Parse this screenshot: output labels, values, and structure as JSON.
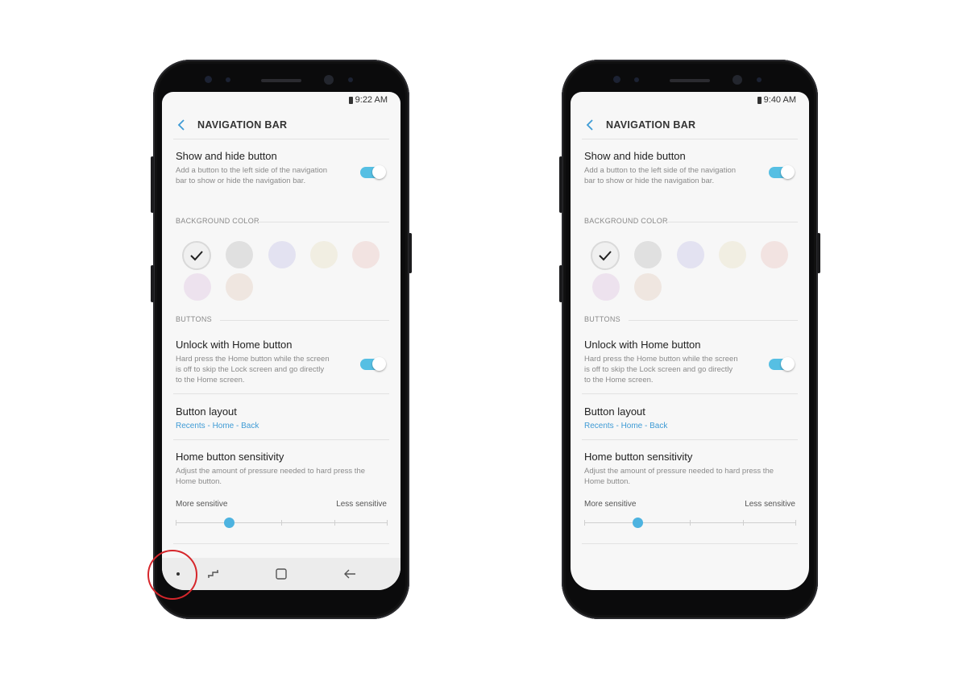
{
  "colors": {
    "accent": "#56bfe3",
    "link": "#3f9bd5",
    "annotation": "#d6262b"
  },
  "icons": {
    "back": "chevron-left-icon",
    "check": "checkmark-icon",
    "nav_dot": "show-hide-dot-icon",
    "nav_recents": "recents-icon",
    "nav_home": "home-icon",
    "nav_back": "back-arrow-icon",
    "battery": "battery-icon"
  },
  "phones": [
    {
      "status_time": "9:22 AM",
      "header_title": "NAVIGATION BAR",
      "show_hide": {
        "title": "Show and hide button",
        "desc": "Add a button to the left side of the navigation bar to show or hide the navigation bar.",
        "enabled": true
      },
      "background_color_label": "BACKGROUND COLOR",
      "swatches": [
        "#f0f0f0",
        "#e0e0e0",
        "#e3e2f1",
        "#f1eee2",
        "#f2e3e1",
        "#ede2ee",
        "#efe6e0"
      ],
      "selected_swatch": 0,
      "buttons_label": "BUTTONS",
      "unlock": {
        "title": "Unlock with Home button",
        "desc": "Hard press the Home button while the screen is off to skip the Lock screen and go directly to the Home screen.",
        "enabled": true
      },
      "layout": {
        "title": "Button layout",
        "value": "Recents - Home - Back"
      },
      "sensitivity": {
        "title": "Home button sensitivity",
        "desc": "Adjust the amount of pressure needed to hard press the Home button.",
        "min_label": "More sensitive",
        "max_label": "Less sensitive",
        "level": 0.25
      },
      "show_navbar": true
    },
    {
      "status_time": "9:40 AM",
      "header_title": "NAVIGATION BAR",
      "show_hide": {
        "title": "Show and hide button",
        "desc": "Add a button to the left side of the navigation bar to show or hide the navigation bar.",
        "enabled": true
      },
      "background_color_label": "BACKGROUND COLOR",
      "swatches": [
        "#f0f0f0",
        "#e0e0e0",
        "#e3e2f1",
        "#f1eee2",
        "#f2e3e1",
        "#ede2ee",
        "#efe6e0"
      ],
      "selected_swatch": 0,
      "buttons_label": "BUTTONS",
      "unlock": {
        "title": "Unlock with Home button",
        "desc": "Hard press the Home button while the screen is off to skip the Lock screen and go directly to the Home screen.",
        "enabled": true
      },
      "layout": {
        "title": "Button layout",
        "value": "Recents - Home - Back"
      },
      "sensitivity": {
        "title": "Home button sensitivity",
        "desc": "Adjust the amount of pressure needed to hard press the Home button.",
        "min_label": "More sensitive",
        "max_label": "Less sensitive",
        "level": 0.25
      },
      "show_navbar": false
    }
  ]
}
